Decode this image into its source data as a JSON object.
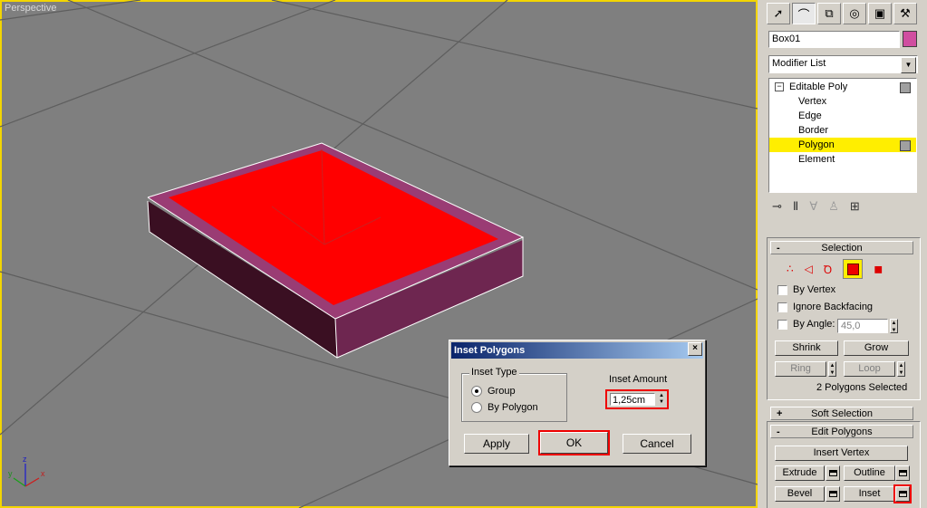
{
  "viewport": {
    "label": "Perspective",
    "axes": {
      "x": "x",
      "y": "y",
      "z": "z"
    }
  },
  "dialog": {
    "title": "Inset Polygons",
    "close": "×",
    "inset_type_label": "Inset Type",
    "options": [
      {
        "label": "Group",
        "selected": true
      },
      {
        "label": "By Polygon",
        "selected": false
      }
    ],
    "inset_amount_label": "Inset Amount",
    "inset_amount_value": "1,25cm",
    "apply_label": "Apply",
    "ok_label": "OK",
    "cancel_label": "Cancel"
  },
  "panel": {
    "tabs": [
      "create-icon",
      "modify-icon",
      "hierarchy-icon",
      "motion-icon",
      "display-icon",
      "utilities-icon"
    ],
    "object_name": "Box01",
    "object_color": "#d04ea0",
    "modifier_list": "Modifier List",
    "stack": {
      "root": "Editable Poly",
      "items": [
        "Vertex",
        "Edge",
        "Border",
        "Polygon",
        "Element"
      ],
      "selected": "Polygon"
    },
    "selection": {
      "title": "Selection",
      "by_vertex": "By Vertex",
      "ignore_backfacing": "Ignore Backfacing",
      "by_angle": "By Angle:",
      "angle_value": "45,0",
      "shrink": "Shrink",
      "grow": "Grow",
      "ring": "Ring",
      "loop": "Loop",
      "status": "2 Polygons Selected"
    },
    "soft_selection": {
      "title": "Soft Selection",
      "toggle": "+"
    },
    "edit_polygons": {
      "title": "Edit Polygons",
      "toggle": "-",
      "insert_vertex": "Insert Vertex",
      "extrude": "Extrude",
      "outline": "Outline",
      "bevel": "Bevel",
      "inset": "Inset"
    },
    "selection_toggle": "-"
  }
}
